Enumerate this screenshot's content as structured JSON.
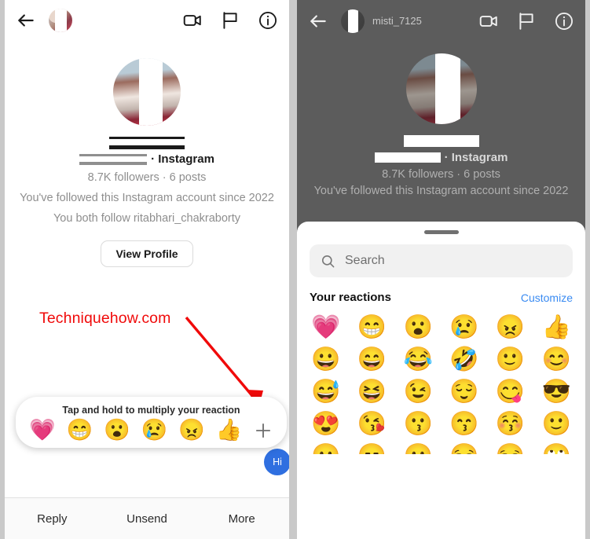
{
  "left": {
    "header": {
      "back_icon": "arrow-left-icon",
      "name_redacted": "",
      "username_redacted": "",
      "video_icon": "video-camera-icon",
      "flag_icon": "flag-icon",
      "info_icon": "info-circle-icon"
    },
    "profile": {
      "name_redacted": "",
      "username_redacted": "",
      "platform": "· Instagram",
      "stats": "8.7K followers · 6 posts",
      "since": "You've followed this Instagram account since 2022",
      "mutual": "You both follow ritabhari_chakraborty",
      "view_profile_label": "View Profile"
    },
    "message_bubble": {
      "text": "Hi"
    },
    "reaction_bar": {
      "hint": "Tap and hold to multiply your reaction",
      "emojis": [
        "💗",
        "😁",
        "😮",
        "😢",
        "😠",
        "👍"
      ],
      "add_icon": "plus-icon"
    },
    "bottom_actions": [
      "Reply",
      "Unsend",
      "More"
    ]
  },
  "right": {
    "header": {
      "back_icon": "arrow-left-icon",
      "name_redacted": "",
      "username": "misti_7125",
      "video_icon": "video-camera-icon",
      "flag_icon": "flag-icon",
      "info_icon": "info-circle-icon"
    },
    "profile": {
      "name_redacted": "",
      "username_redacted": "",
      "platform": "· Instagram",
      "stats": "8.7K followers · 6 posts",
      "since": "You've followed this Instagram account since 2022"
    },
    "sheet": {
      "grabber": "drag-handle",
      "search": {
        "placeholder": "Search",
        "value": "",
        "icon": "search-icon"
      },
      "section_title": "Your reactions",
      "section_action": "Customize",
      "rows": [
        [
          "💗",
          "😁",
          "😮",
          "😢",
          "😠",
          "👍"
        ],
        [
          "😀",
          "😄",
          "😂",
          "🤣",
          "🙂",
          "😊"
        ],
        [
          "😅",
          "😆",
          "😉",
          "😌",
          "😋",
          "😎"
        ],
        [
          "😍",
          "😘",
          "😗",
          "😙",
          "😚",
          "🙂"
        ],
        [
          "😐",
          "😑",
          "😶",
          "😏",
          "😒",
          "🙄"
        ]
      ]
    }
  },
  "watermark": {
    "text": "Techniquehow.com",
    "color": "#f00a0a",
    "arrow": "red-arrow"
  },
  "colors": {
    "accent_blue": "#3a8bf2",
    "bubble_blue": "#2f6fe0",
    "heart_pink": "#e0559a",
    "muted_text": "#8e8e8e",
    "page_bg": "#c9c9c9"
  }
}
